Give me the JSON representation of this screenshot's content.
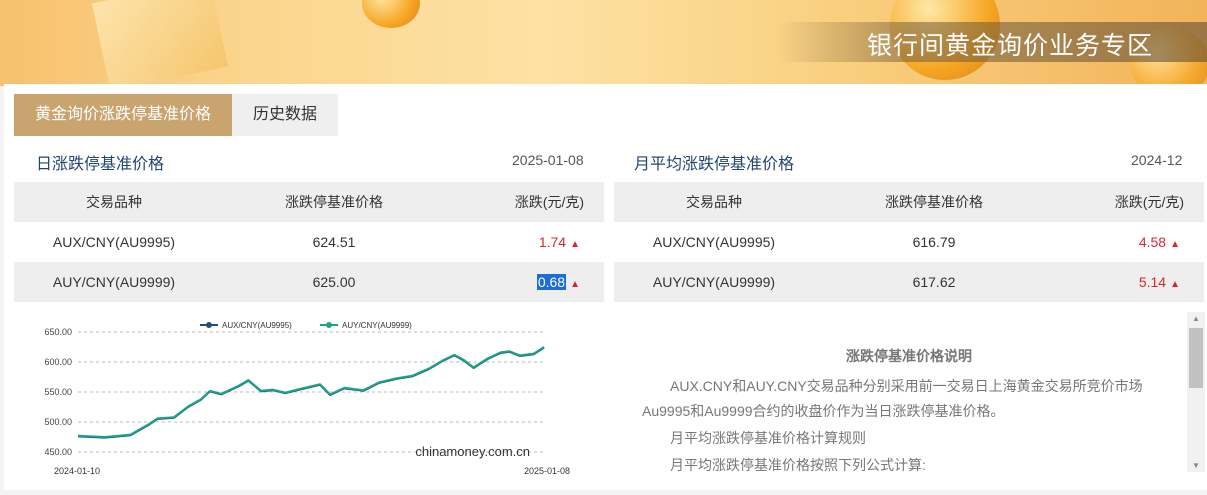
{
  "banner": {
    "title": "银行间黄金询价业务专区"
  },
  "tabs": [
    {
      "label": "黄金询价涨跌停基准价格",
      "active": true
    },
    {
      "label": "历史数据",
      "active": false
    }
  ],
  "daily": {
    "title": "日涨跌停基准价格",
    "date": "2025-01-08",
    "headers": [
      "交易品种",
      "涨跌停基准价格",
      "涨跌(元/克)"
    ],
    "rows": [
      {
        "product": "AUX/CNY(AU9995)",
        "price": "624.51",
        "change": "1.74",
        "direction": "up"
      },
      {
        "product": "AUY/CNY(AU9999)",
        "price": "625.00",
        "change": "0.68",
        "direction": "up"
      }
    ]
  },
  "monthly": {
    "title": "月平均涨跌停基准价格",
    "date": "2024-12",
    "headers": [
      "交易品种",
      "涨跌停基准价格",
      "涨跌(元/克)"
    ],
    "rows": [
      {
        "product": "AUX/CNY(AU9995)",
        "price": "616.79",
        "change": "4.58",
        "direction": "up"
      },
      {
        "product": "AUY/CNY(AU9999)",
        "price": "617.62",
        "change": "5.14",
        "direction": "up"
      }
    ]
  },
  "description": {
    "title": "涨跌停基准价格说明",
    "p1_line1": "AUX.CNY和AUY.CNY交易品种分别采用前一交易日上海黄金交易所竞价市场",
    "p1_line2": "Au9995和Au9999合约的收盘价作为当日涨跌停基准价格。",
    "p2": "月平均涨跌停基准价格计算规则",
    "p3": "月平均涨跌停基准价格按照下列公式计算:"
  },
  "colors": {
    "accent": "#c9a46f",
    "up": "#d8272f",
    "series1": "#1f4e79",
    "series2": "#1aa584"
  },
  "chart_data": {
    "type": "line",
    "watermark": "chinamoney.com.cn",
    "xlabel": "",
    "ylabel": "",
    "x_range": [
      "2024-01-10",
      "2025-01-08"
    ],
    "x_ticks": [
      "2024-01-10",
      "2025-01-08"
    ],
    "ylim": [
      440,
      650
    ],
    "y_ticks": [
      "450.00",
      "500.00",
      "550.00",
      "600.00",
      "650.00"
    ],
    "legend_position": "top",
    "series": [
      {
        "name": "AUX/CNY(AU9995)",
        "x": [
          "2024-01-10",
          "2024-01-31",
          "2024-02-20",
          "2024-03-05",
          "2024-03-12",
          "2024-03-25",
          "2024-04-05",
          "2024-04-15",
          "2024-04-22",
          "2024-05-01",
          "2024-05-15",
          "2024-05-22",
          "2024-06-01",
          "2024-06-10",
          "2024-06-20",
          "2024-07-01",
          "2024-07-17",
          "2024-07-25",
          "2024-08-05",
          "2024-08-20",
          "2024-09-01",
          "2024-09-15",
          "2024-09-27",
          "2024-10-10",
          "2024-10-22",
          "2024-10-30",
          "2024-11-06",
          "2024-11-14",
          "2024-11-25",
          "2024-12-05",
          "2024-12-12",
          "2024-12-20",
          "2024-12-31",
          "2025-01-08"
        ],
        "values": [
          476,
          474,
          478,
          495,
          505,
          507,
          525,
          537,
          551,
          546,
          560,
          569,
          551,
          553,
          548,
          554,
          562,
          545,
          556,
          552,
          565,
          572,
          576,
          588,
          603,
          611,
          603,
          590,
          605,
          615,
          617,
          610,
          613,
          624
        ]
      },
      {
        "name": "AUY/CNY(AU9999)",
        "x": [
          "2024-01-10",
          "2024-01-31",
          "2024-02-20",
          "2024-03-05",
          "2024-03-12",
          "2024-03-25",
          "2024-04-05",
          "2024-04-15",
          "2024-04-22",
          "2024-05-01",
          "2024-05-15",
          "2024-05-22",
          "2024-06-01",
          "2024-06-10",
          "2024-06-20",
          "2024-07-01",
          "2024-07-17",
          "2024-07-25",
          "2024-08-05",
          "2024-08-20",
          "2024-09-01",
          "2024-09-15",
          "2024-09-27",
          "2024-10-10",
          "2024-10-22",
          "2024-10-30",
          "2024-11-06",
          "2024-11-14",
          "2024-11-25",
          "2024-12-05",
          "2024-12-12",
          "2024-12-20",
          "2024-12-31",
          "2025-01-08"
        ],
        "values": [
          477,
          475,
          479,
          496,
          506,
          508,
          526,
          538,
          552,
          547,
          561,
          570,
          552,
          554,
          549,
          555,
          563,
          546,
          557,
          553,
          566,
          573,
          577,
          589,
          604,
          612,
          604,
          591,
          606,
          616,
          618,
          611,
          614,
          625
        ]
      }
    ]
  }
}
